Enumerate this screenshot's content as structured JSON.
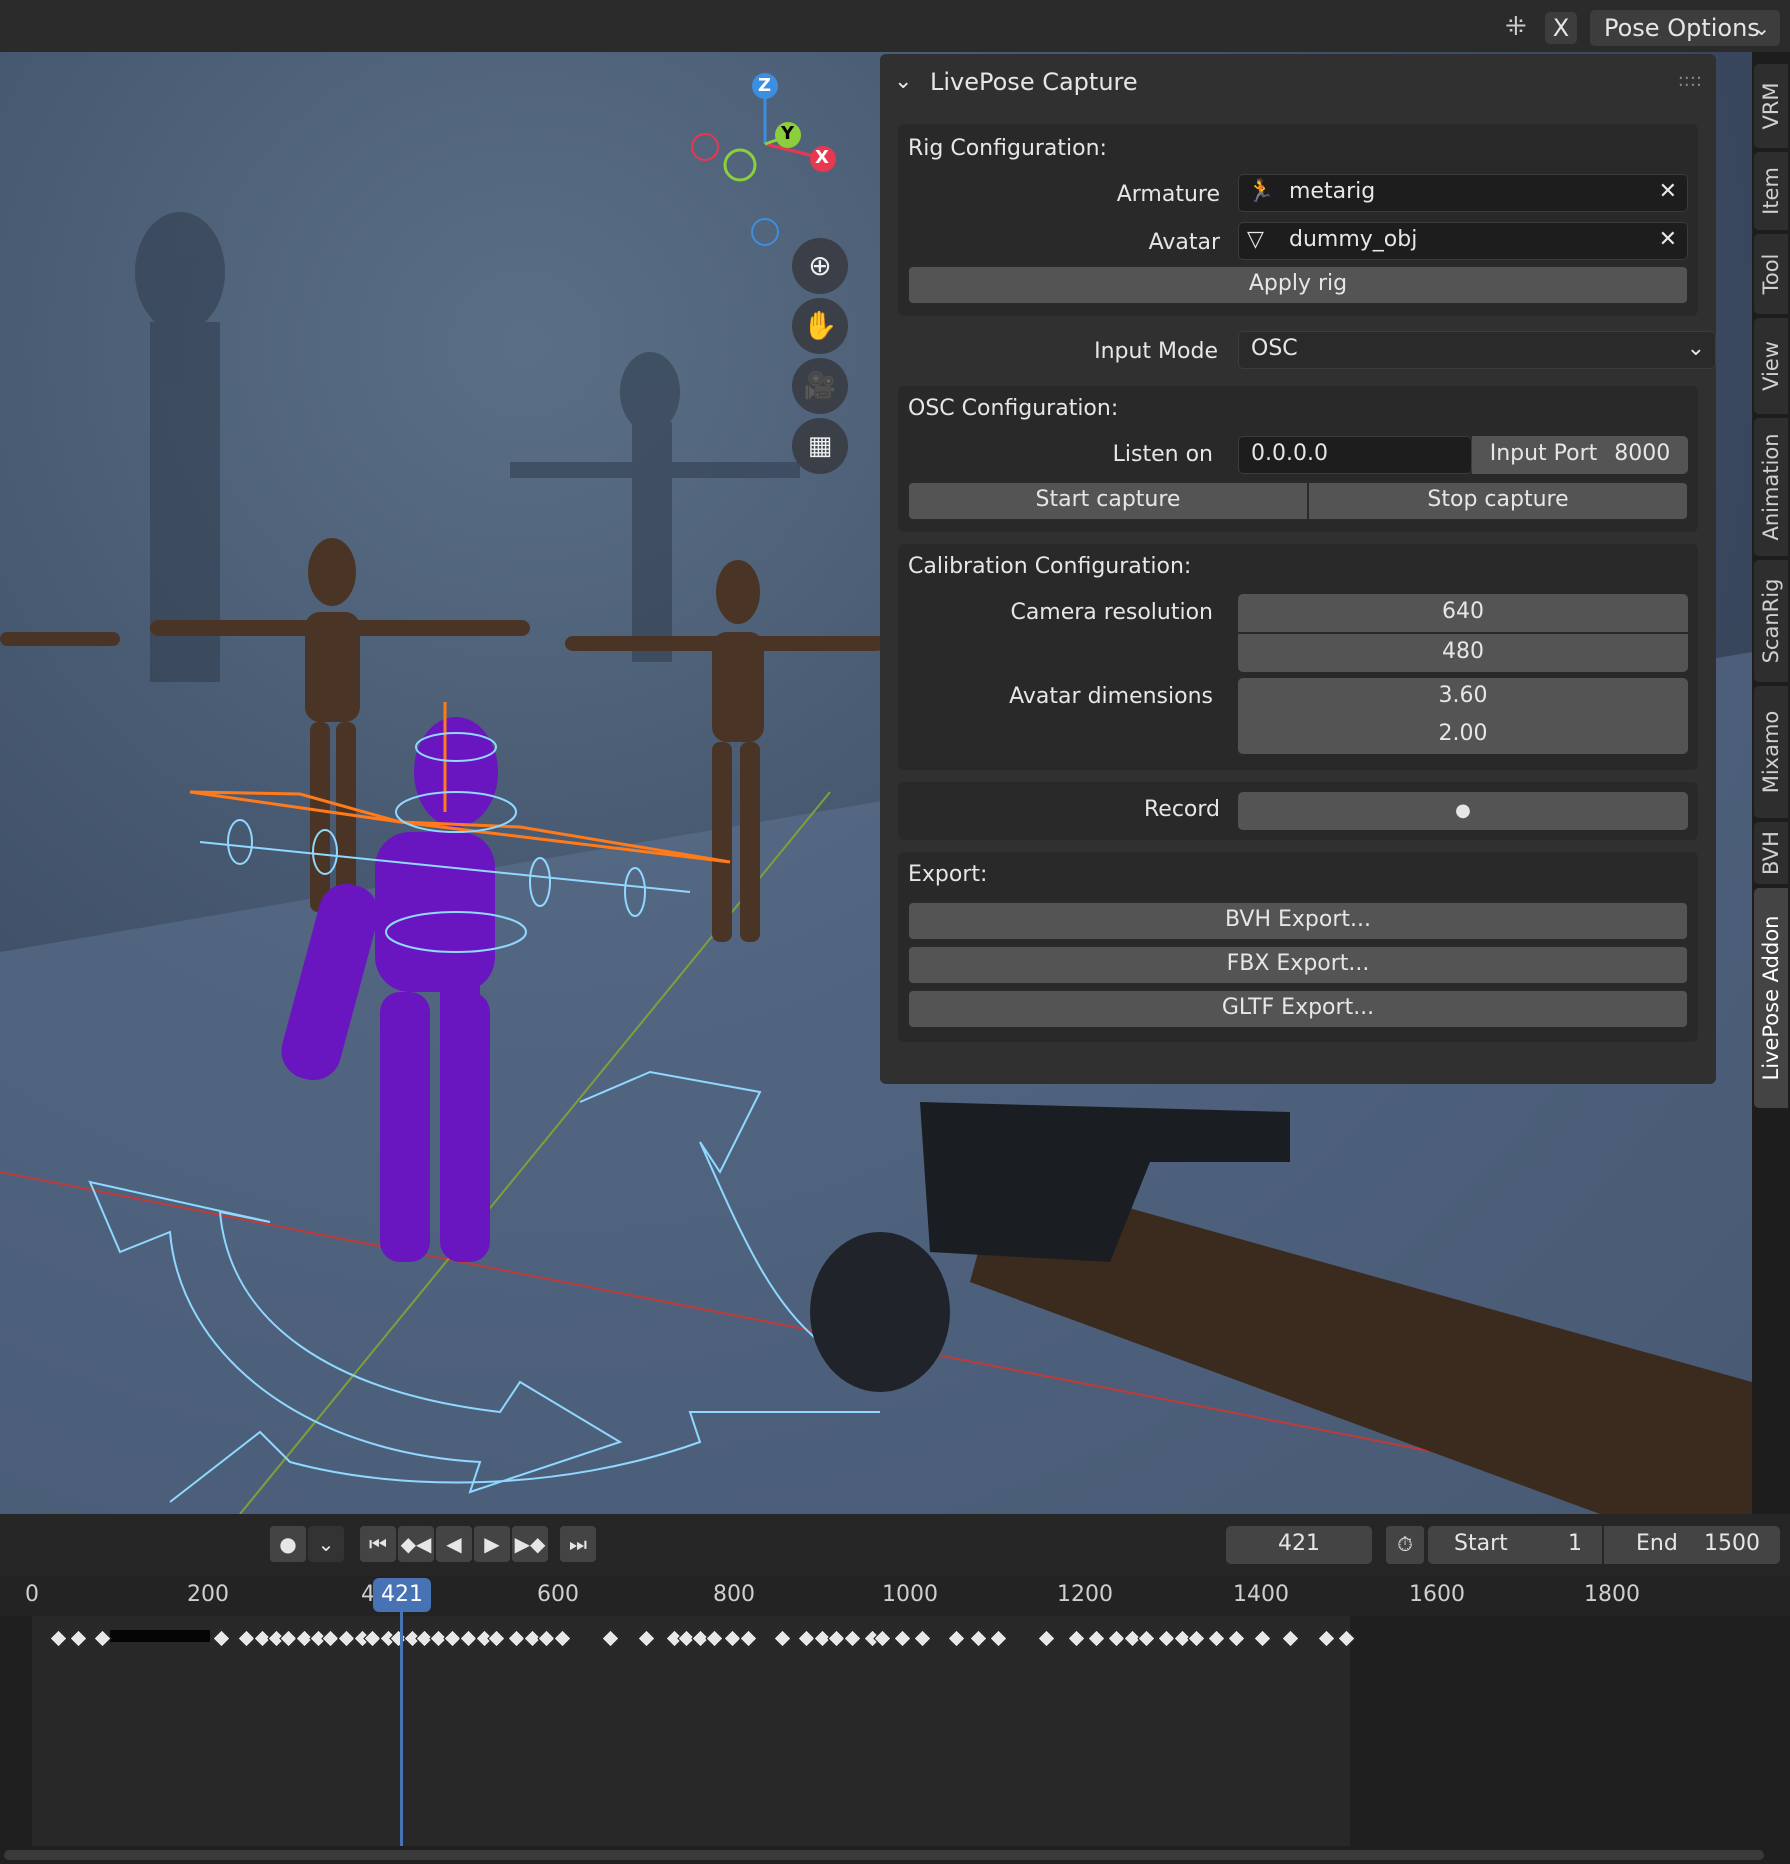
{
  "header": {
    "close_label": "X",
    "mode_dropdown": "Pose Options"
  },
  "panel": {
    "title": "LivePose Capture",
    "rig": {
      "heading": "Rig Configuration:",
      "armature_label": "Armature",
      "armature_value": "metarig",
      "avatar_label": "Avatar",
      "avatar_value": "dummy_obj",
      "apply_button": "Apply rig"
    },
    "input_mode": {
      "label": "Input Mode",
      "value": "OSC"
    },
    "osc": {
      "heading": "OSC Configuration:",
      "listen_label": "Listen on",
      "listen_value": "0.0.0.0",
      "port_label": "Input Port",
      "port_value": "8000",
      "start_button": "Start capture",
      "stop_button": "Stop capture"
    },
    "calibration": {
      "heading": "Calibration Configuration:",
      "cam_res_label": "Camera resolution",
      "cam_res_x": "640",
      "cam_res_y": "480",
      "avatar_dim_label": "Avatar dimensions",
      "avatar_dim_x": "3.60",
      "avatar_dim_y": "2.00"
    },
    "record": {
      "label": "Record"
    },
    "export": {
      "heading": "Export:",
      "bvh": "BVH Export...",
      "fbx": "FBX Export...",
      "gltf": "GLTF Export..."
    }
  },
  "side_tabs": [
    "VRM",
    "Item",
    "Tool",
    "View",
    "Animation",
    "ScanRig",
    "Mixamo",
    "BVH",
    "LivePose Addon"
  ],
  "gizmo": {
    "x": "X",
    "y": "Y",
    "z": "Z"
  },
  "timeline": {
    "current_frame": "421",
    "start_label": "Start",
    "start_value": "1",
    "end_label": "End",
    "end_value": "1500",
    "ruler_ticks": [
      "0",
      "200",
      "4",
      "600",
      "800",
      "1000",
      "1200",
      "1400",
      "1600",
      "1800"
    ],
    "playhead_label": "421"
  },
  "colors": {
    "accent_blue": "#4772b3",
    "x_axis": "#e8384f",
    "y_axis": "#8bd03c",
    "z_axis": "#3c8ee0"
  }
}
